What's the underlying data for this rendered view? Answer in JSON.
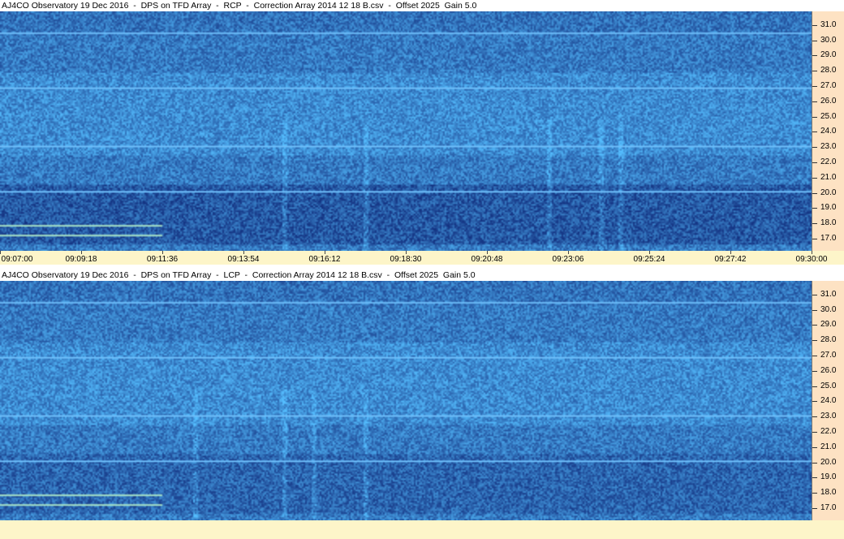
{
  "panels": [
    {
      "title": "AJ4CO Observatory 19 Dec 2016  -  DPS on TFD Array  -  RCP  -  Correction Array 2014 12 18 B.csv  -  Offset 2025  Gain 5.0",
      "polarization": "RCP"
    },
    {
      "title": "AJ4CO Observatory 19 Dec 2016  -  DPS on TFD Array  -  LCP  -  Correction Array 2014 12 18 B.csv  -  Offset 2025  Gain 5.0",
      "polarization": "LCP"
    }
  ],
  "x_axis": {
    "tick_labels": [
      "09:07:00",
      "09:09:18",
      "09:11:36",
      "09:13:54",
      "09:16:12",
      "09:18:30",
      "09:20:48",
      "09:23:06",
      "09:25:24",
      "09:27:42",
      "09:30:00"
    ]
  },
  "y_axis": {
    "tick_labels": [
      "31.0",
      "30.0",
      "29.0",
      "28.0",
      "27.0",
      "26.0",
      "25.0",
      "24.0",
      "23.0",
      "22.0",
      "21.0",
      "20.0",
      "19.0",
      "18.0",
      "17.0"
    ]
  },
  "colors": {
    "spectrogram_base": "#1f49d6",
    "axis_y_background": "#fde2c3",
    "axis_x_background": "#fdf5c9"
  },
  "chart_data": [
    {
      "type": "heatmap",
      "title": "AJ4CO Observatory 19 Dec 2016  -  DPS on TFD Array  -  RCP  -  Correction Array 2014 12 18 B.csv  -  Offset 2025  Gain 5.0",
      "x": [
        "09:07:00",
        "09:09:18",
        "09:11:36",
        "09:13:54",
        "09:16:12",
        "09:18:30",
        "09:20:48",
        "09:23:06",
        "09:25:24",
        "09:27:42",
        "09:30:00"
      ],
      "y": [
        31.0,
        30.0,
        29.0,
        28.0,
        27.0,
        26.0,
        25.0,
        24.0,
        23.0,
        22.0,
        21.0,
        20.0,
        19.0,
        18.0,
        17.0
      ],
      "xlim": [
        "09:07:00",
        "09:30:00"
      ],
      "ylim": [
        16.2,
        31.9
      ]
    },
    {
      "type": "heatmap",
      "title": "AJ4CO Observatory 19 Dec 2016  -  DPS on TFD Array  -  LCP  -  Correction Array 2014 12 18 B.csv  -  Offset 2025  Gain 5.0",
      "x": [
        "09:07:00",
        "09:09:18",
        "09:11:36",
        "09:13:54",
        "09:16:12",
        "09:18:30",
        "09:20:48",
        "09:23:06",
        "09:25:24",
        "09:27:42",
        "09:30:00"
      ],
      "y": [
        31.0,
        30.0,
        29.0,
        28.0,
        27.0,
        26.0,
        25.0,
        24.0,
        23.0,
        22.0,
        21.0,
        20.0,
        19.0,
        18.0,
        17.0
      ],
      "xlim": [
        "09:07:00",
        "09:30:00"
      ],
      "ylim": [
        16.2,
        31.9
      ]
    }
  ]
}
